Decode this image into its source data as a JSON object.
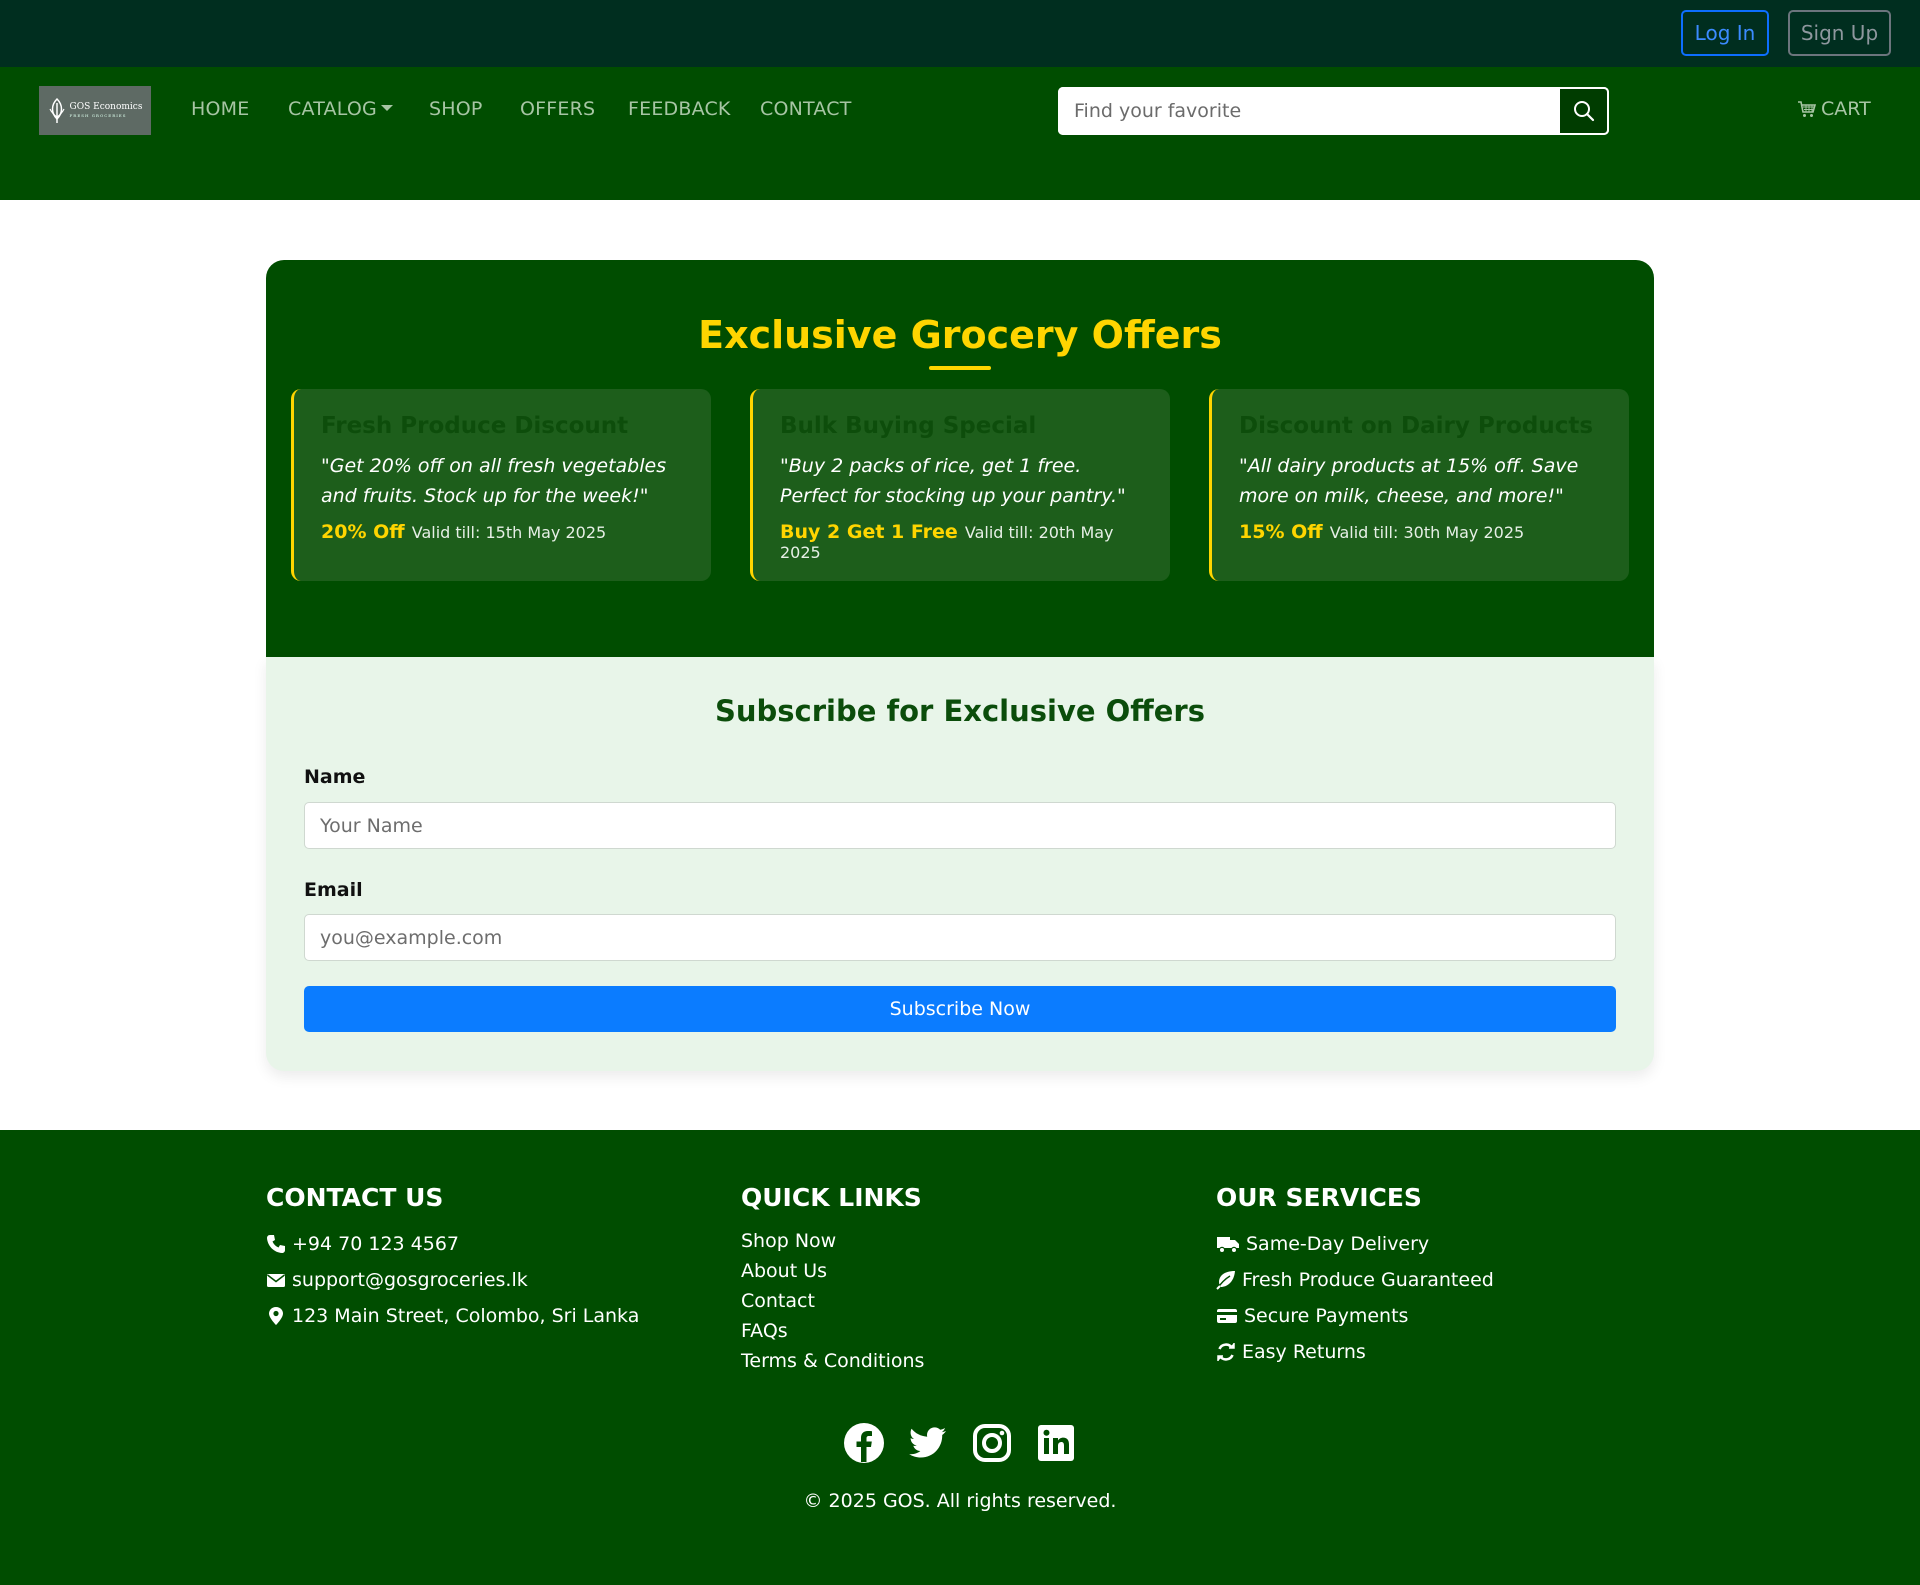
{
  "auth": {
    "login_label": "Log In",
    "signup_label": "Sign Up"
  },
  "brand": {
    "logo_text": "GOS Economics",
    "logo_subtext": "FRESH GROCERIES"
  },
  "nav": {
    "items": [
      "HOME",
      "CATALOG",
      "SHOP",
      "OFFERS",
      "FEEDBACK",
      "CONTACT"
    ],
    "search_placeholder": "Find your favorite",
    "cart_label": "CART"
  },
  "offers": {
    "title": "Exclusive Grocery Offers",
    "cards": [
      {
        "name": "Fresh Produce Discount",
        "quote": "\"Get 20% off on all fresh vegetables and fruits. Stock up for the week!\"",
        "badge": "20% Off",
        "valid": "Valid till: 15th May 2025"
      },
      {
        "name": "Bulk Buying Special",
        "quote": "\"Buy 2 packs of rice, get 1 free. Perfect for stocking up your pantry.\"",
        "badge": "Buy 2 Get 1 Free",
        "valid": "Valid till: 20th May 2025"
      },
      {
        "name": "Discount on Dairy Products",
        "quote": "\"All dairy products at 15% off. Save more on milk, cheese, and more!\"",
        "badge": "15% Off",
        "valid": "Valid till: 30th May 2025"
      }
    ]
  },
  "subscribe": {
    "title": "Subscribe for Exclusive Offers",
    "name_label": "Name",
    "name_placeholder": "Your Name",
    "email_label": "Email",
    "email_placeholder": "you@example.com",
    "button_label": "Subscribe Now"
  },
  "footer": {
    "contact": {
      "heading": "CONTACT US",
      "phone": "+94 70 123 4567",
      "email": "support@gosgroceries.lk",
      "address": "123 Main Street, Colombo, Sri Lanka"
    },
    "quick_links": {
      "heading": "QUICK LINKS",
      "items": [
        "Shop Now",
        "About Us",
        "Contact",
        "FAQs",
        "Terms & Conditions"
      ]
    },
    "services": {
      "heading": "OUR SERVICES",
      "items": [
        "Same-Day Delivery",
        "Fresh Produce Guaranteed",
        "Secure Payments",
        "Easy Returns"
      ]
    },
    "social_icons": [
      "facebook-icon",
      "twitter-icon",
      "instagram-icon",
      "linkedin-icon"
    ],
    "copyright": "© 2025 GOS. All rights reserved."
  },
  "colors": {
    "topbar": "#002e1f",
    "primary_green": "#004d00",
    "accent_yellow": "#ffd500",
    "subscribe_bg": "#e8f5e9",
    "button_blue": "#0b7cff"
  }
}
